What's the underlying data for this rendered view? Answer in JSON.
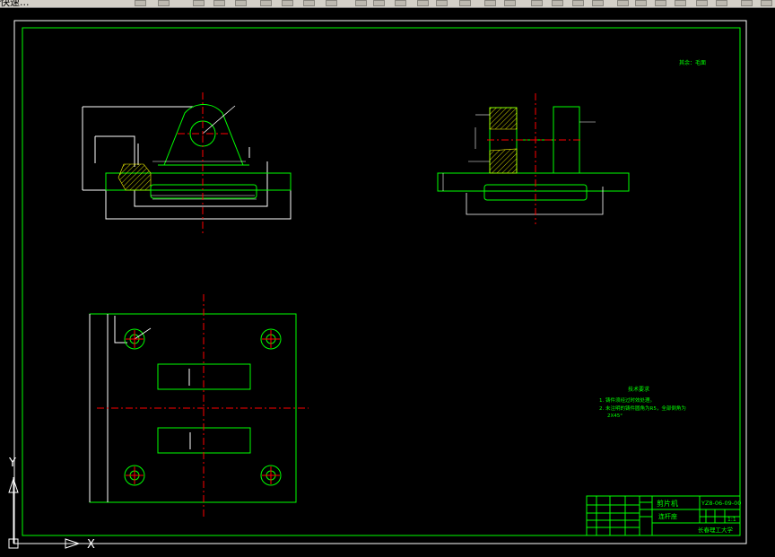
{
  "window": {
    "title": "快速..."
  },
  "drawing": {
    "top_right_note": "其余：毛面",
    "tech_req": {
      "heading": "技术要求",
      "line1": "1. 铸件须经过时效处理。",
      "line2": "2. 未注明的铸件圆角为R5，全部倒角为",
      "line3": "2X45°"
    },
    "title_block": {
      "part_name": "剪片机",
      "part_sub": "连杆座",
      "drawing_no": "YZ8-06-09-00",
      "scale": "1:1",
      "school": "长春理工大学"
    },
    "ucs": {
      "x_label": "X",
      "y_label": "Y"
    }
  },
  "colors": {
    "green": "#00ff00",
    "white": "#ffffff",
    "red": "#ff0000",
    "yellow": "#ffff00",
    "background": "#000000"
  }
}
